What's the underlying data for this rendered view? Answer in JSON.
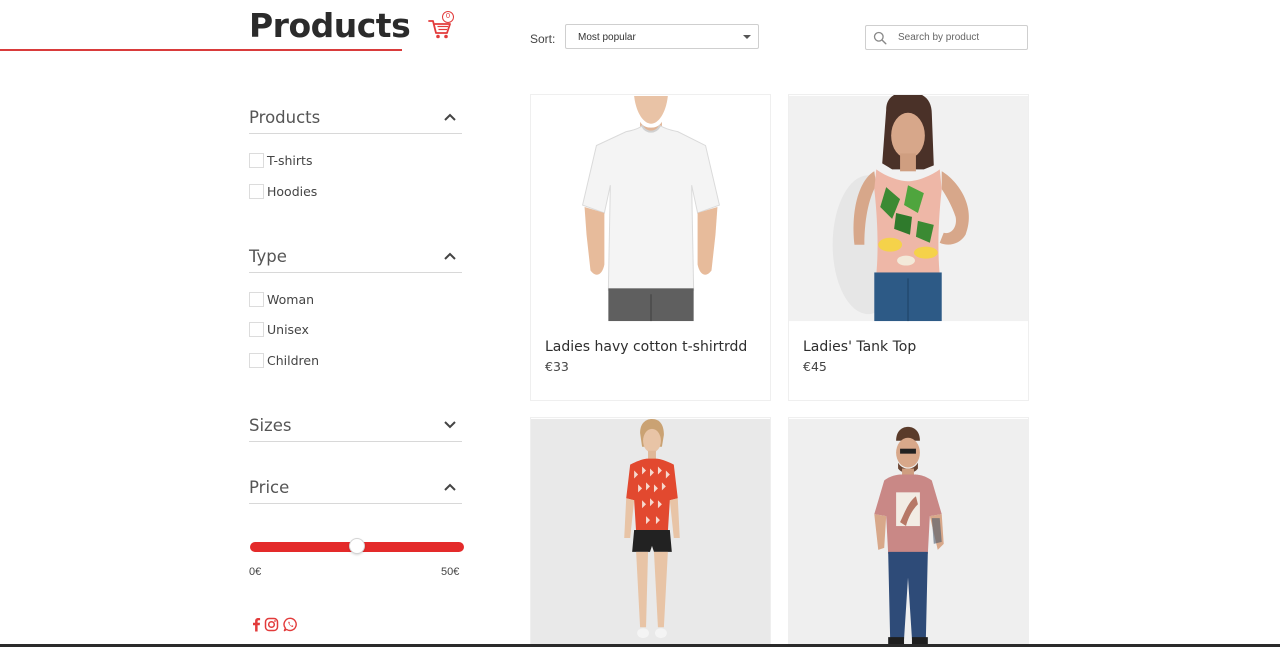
{
  "header": {
    "title": "Products",
    "cart_count": "0",
    "sort_label": "Sort:",
    "sort_selected": "Most popular",
    "search_placeholder": "Search by product"
  },
  "filters": {
    "products": {
      "title": "Products",
      "expanded": true,
      "options": [
        "T-shirts",
        "Hoodies"
      ]
    },
    "type": {
      "title": "Type",
      "expanded": true,
      "options": [
        "Woman",
        "Unisex",
        "Children"
      ]
    },
    "sizes": {
      "title": "Sizes",
      "expanded": false
    },
    "price": {
      "title": "Price",
      "expanded": true,
      "min_label": "0€",
      "max_label": "50€",
      "slider_value_fraction": 0.5
    }
  },
  "social": [
    "facebook-icon",
    "instagram-icon",
    "whatsapp-icon"
  ],
  "products": [
    {
      "name": "Ladies havy cotton t-shirtrdd",
      "price": "€33"
    },
    {
      "name": "Ladies' Tank Top",
      "price": "€45"
    },
    {
      "name": "",
      "price": ""
    },
    {
      "name": "",
      "price": ""
    }
  ],
  "colors": {
    "accent": "#e42a2a",
    "brand_red": "#d93b3b"
  }
}
